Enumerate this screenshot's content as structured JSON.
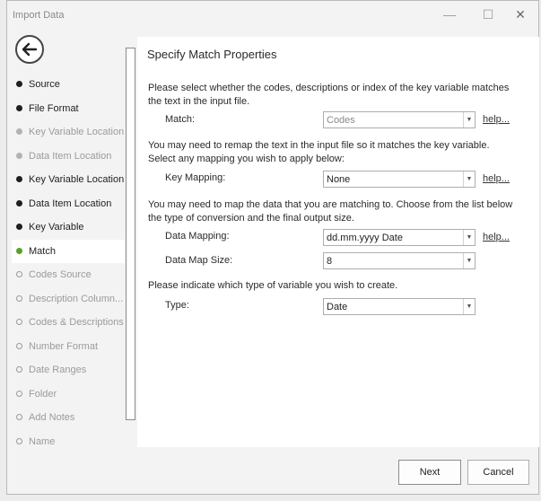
{
  "window": {
    "title": "Import Data",
    "minimize_glyph": "—",
    "maximize_glyph": "☐",
    "close_glyph": "✕"
  },
  "steps": [
    {
      "label": "Source",
      "state": "done"
    },
    {
      "label": "File Format",
      "state": "done"
    },
    {
      "label": "Key Variable Location",
      "state": "skipped"
    },
    {
      "label": "Data Item Location",
      "state": "skipped"
    },
    {
      "label": "Key Variable Location",
      "state": "done"
    },
    {
      "label": "Data Item Location",
      "state": "done"
    },
    {
      "label": "Key Variable",
      "state": "done"
    },
    {
      "label": "Match",
      "state": "current"
    },
    {
      "label": "Codes Source",
      "state": "pending"
    },
    {
      "label": "Description  Column...",
      "state": "pending"
    },
    {
      "label": "Codes & Descriptions",
      "state": "pending"
    },
    {
      "label": "Number Format",
      "state": "pending"
    },
    {
      "label": "Date Ranges",
      "state": "pending"
    },
    {
      "label": "Folder",
      "state": "pending"
    },
    {
      "label": "Add Notes",
      "state": "pending"
    },
    {
      "label": "Name",
      "state": "pending"
    }
  ],
  "panel": {
    "title": "Specify Match Properties",
    "intro": "Please select whether the codes, descriptions or index of the key variable matches the text in the input file.",
    "match": {
      "label": "Match:",
      "value": "Codes",
      "help": "help..."
    },
    "remap_text": "You may need to remap the text in the input file so it matches the key variable. Select any mapping you wish to apply below:",
    "key_mapping": {
      "label": "Key Mapping:",
      "value": "None",
      "help": "help..."
    },
    "map_text": "You may need to map the data that you are matching to.  Choose from the list below the type of conversion and the final output size.",
    "data_mapping": {
      "label": "Data Mapping:",
      "value": "dd.mm.yyyy Date",
      "help": "help..."
    },
    "data_map_size": {
      "label": "Data Map Size:",
      "value": "8"
    },
    "type_text": "Please indicate which type of variable you wish to create.",
    "type": {
      "label": "Type:",
      "value": "Date"
    }
  },
  "buttons": {
    "next": "Next",
    "cancel": "Cancel"
  },
  "colors": {
    "current_step_dot": "#5aa02c",
    "panel_background": "#ffffff"
  }
}
